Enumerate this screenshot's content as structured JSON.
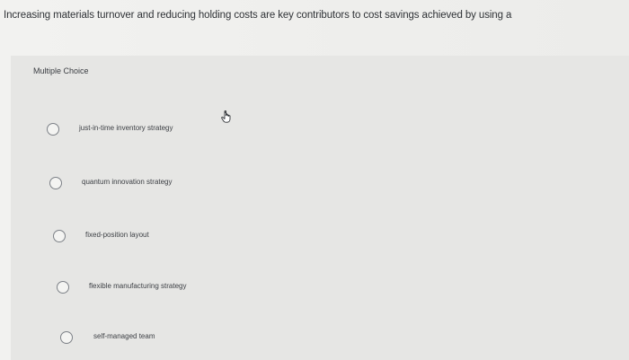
{
  "question": {
    "text": "Increasing materials turnover and reducing holding costs are key contributors to cost savings achieved by using a"
  },
  "multiple_choice": {
    "label": "Multiple Choice",
    "options": [
      {
        "label": "just-in-time inventory strategy",
        "selected": false
      },
      {
        "label": "quantum innovation strategy",
        "selected": false
      },
      {
        "label": "fixed-position layout",
        "selected": false
      },
      {
        "label": "flexible manufacturing strategy",
        "selected": false
      },
      {
        "label": "self-managed team",
        "selected": false
      }
    ]
  },
  "cursor": {
    "icon": "hand-pointer-icon"
  }
}
